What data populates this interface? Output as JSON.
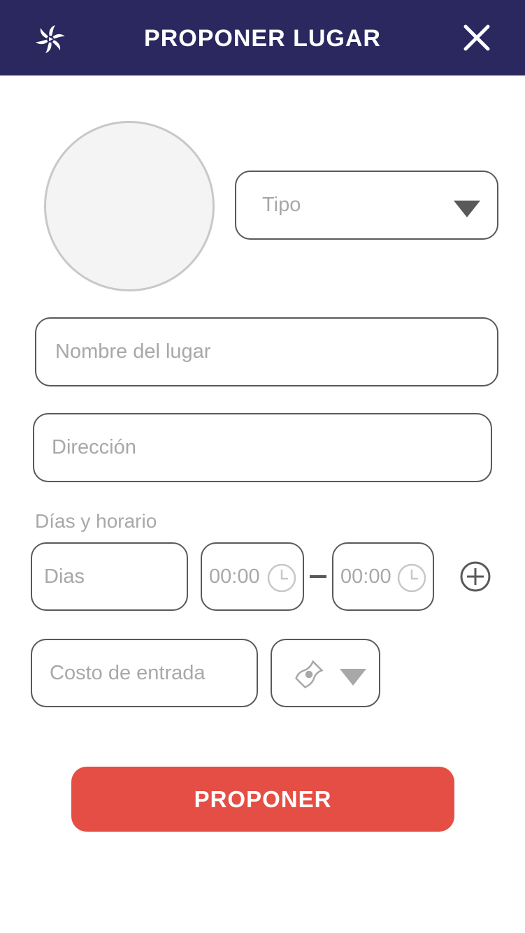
{
  "header": {
    "title": "PROPONER LUGAR",
    "background": "#2a285e",
    "logo_icon": "pinwheel-logo-icon",
    "close_icon": "close-icon"
  },
  "form": {
    "photo_placeholder": "photo-circle",
    "tipo": {
      "placeholder": "Tipo",
      "icon": "dropdown-triangle-icon"
    },
    "nombre": {
      "placeholder": "Nombre del lugar"
    },
    "direccion": {
      "placeholder": "Dirección"
    },
    "schedule": {
      "label": "Días y horario",
      "dias_placeholder": "Dias",
      "start_time": "00:00",
      "end_time": "00:00",
      "clock_icon": "clock-icon",
      "add_icon": "add-circle-icon"
    },
    "costo": {
      "placeholder": "Costo de entrada"
    },
    "moneda": {
      "icon": "money-bill-icon",
      "dropdown_icon": "dropdown-triangle-icon"
    }
  },
  "actions": {
    "submit_label": "PROPONER",
    "submit_color": "#e54e45"
  }
}
